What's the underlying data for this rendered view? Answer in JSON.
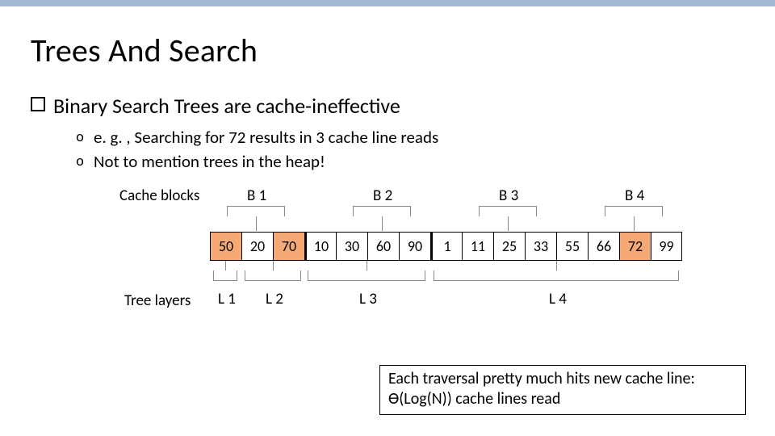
{
  "title": "Trees And Search",
  "bullets": [
    {
      "text": "Binary Search Trees are cache-ineffective"
    }
  ],
  "subbullets": [
    {
      "text": "e. g. , Searching for 72 results in 3 cache line reads"
    },
    {
      "text": "Not to mention trees in the heap!"
    }
  ],
  "diagram": {
    "cache_blocks_label": "Cache blocks",
    "tree_layers_label": "Tree layers",
    "blocks": [
      "B 1",
      "B 2",
      "B 3",
      "B 4"
    ],
    "layers": [
      "L 1",
      "L 2",
      "L 3",
      "L 4"
    ],
    "cells": [
      {
        "v": "50",
        "hi": true
      },
      {
        "v": "20",
        "hi": false
      },
      {
        "v": "70",
        "hi": true
      },
      {
        "v": "10",
        "hi": false
      },
      {
        "v": "30",
        "hi": false
      },
      {
        "v": "60",
        "hi": false
      },
      {
        "v": "90",
        "hi": false
      },
      {
        "v": "1",
        "hi": false
      },
      {
        "v": "11",
        "hi": false
      },
      {
        "v": "25",
        "hi": false
      },
      {
        "v": "33",
        "hi": false
      },
      {
        "v": "55",
        "hi": false
      },
      {
        "v": "66",
        "hi": false
      },
      {
        "v": "72",
        "hi": true
      },
      {
        "v": "99",
        "hi": false
      }
    ]
  },
  "note": {
    "line1": "Each traversal pretty much hits new cache line:",
    "line2": "Ɵ(Log(N)) cache lines read"
  }
}
